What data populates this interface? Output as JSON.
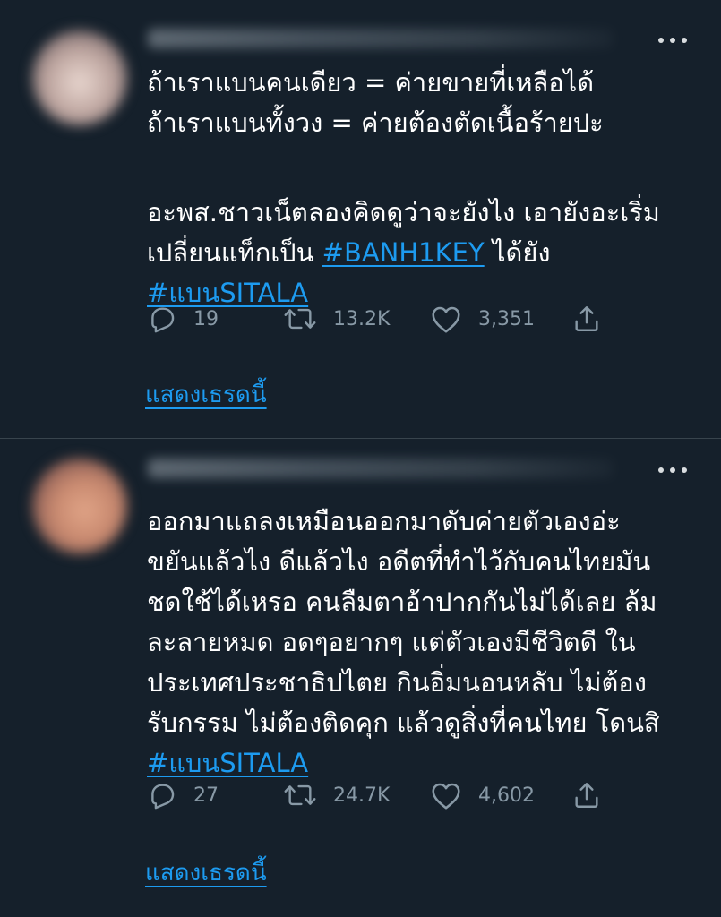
{
  "tweets": [
    {
      "lines": [
        "ถ้าเราแบนคนเดียว = ค่ายขายที่เหลือได้",
        "ถ้าเราแบนทั้งวง = ค่ายต้องตัดเนื้อร้ายปะ",
        "",
        "อะพส.ชาวเน็ตลองคิดดูว่าจะยังไง เอายังอะเริ่ม"
      ],
      "line5_prefix": "เปลี่ยนแท็กเป็น ",
      "line5_hashtag": "#BANH1KEY",
      "line5_suffix": " ได้ยัง",
      "hashtag": "#แบนSITALA",
      "replies": "19",
      "retweets": "13.2K",
      "likes": "3,351",
      "show_thread": "แสดงเธรดนี้"
    },
    {
      "lines": [
        "ออกมาแถลงเหมือนออกมาดับค่ายตัวเองอ่ะ",
        "ขยันแล้วไง ดีแล้วไง อดีตที่ทำไว้กับคนไทยมัน",
        "ชดใช้ได้เหรอ คนลืมตาอ้าปากกันไม่ได้เลย ล้ม",
        "ละลายหมด อดๆอยากๆ แต่ตัวเองมีชีวิตดี ใน",
        "ประเทศประชาธิปไตย กินอิ่มนอนหลับ ไม่ต้อง",
        "รับกรรม ไม่ต้องติดคุก แล้วดูสิ่งที่คนไทย โดนสิ"
      ],
      "hashtag": "#แบนSITALA",
      "replies": "27",
      "retweets": "24.7K",
      "likes": "4,602",
      "show_thread": "แสดงเธรดนี้"
    }
  ],
  "icons": {
    "reply": "reply-icon",
    "retweet": "retweet-icon",
    "like": "heart-icon",
    "share": "share-icon",
    "more": "more-icon"
  },
  "colors": {
    "background": "#15202b",
    "text": "#ffffff",
    "secondary": "#8899a6",
    "link": "#1d9bf0",
    "divider": "#38444d"
  }
}
